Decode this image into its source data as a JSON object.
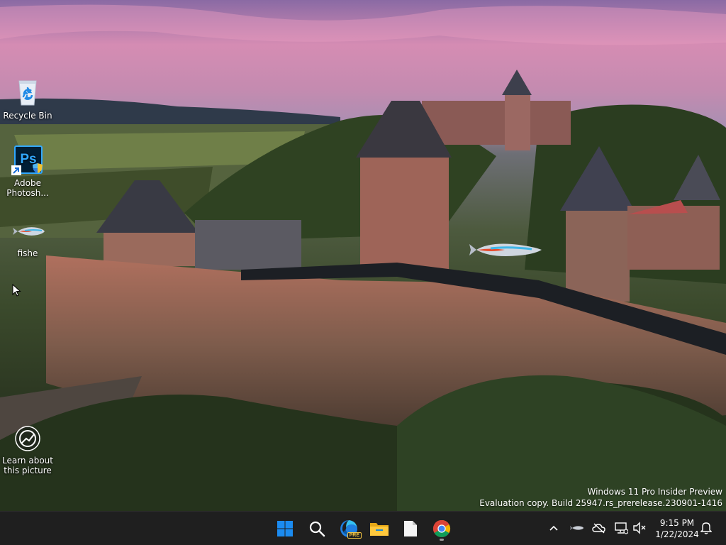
{
  "desktop": {
    "icons": [
      {
        "label": "Recycle Bin",
        "icon": "recycle-bin-icon"
      },
      {
        "label": "Adobe Photosh...",
        "icon": "photoshop-icon",
        "glyph": "Ps"
      },
      {
        "label": "fishe",
        "icon": "fish-icon"
      },
      {
        "label": "Learn about this picture",
        "icon": "learn-about-picture-icon"
      }
    ],
    "watermark": {
      "line1": "Windows 11 Pro Insider Preview",
      "line2": "Evaluation copy. Build 25947.rs_prerelease.230901-1416"
    }
  },
  "taskbar": {
    "apps": [
      {
        "name": "Start",
        "icon": "windows-start-icon"
      },
      {
        "name": "Search",
        "icon": "search-icon"
      },
      {
        "name": "Microsoft Edge Preview",
        "icon": "edge-icon",
        "badge": "PRE"
      },
      {
        "name": "File Explorer",
        "icon": "folder-icon"
      },
      {
        "name": "Notepad",
        "icon": "notepad-icon"
      },
      {
        "name": "Google Chrome",
        "icon": "chrome-icon",
        "running": true
      }
    ],
    "tray": {
      "icons": [
        "chevron-up-icon",
        "fish-tray-icon",
        "cloud-offline-icon",
        "network-icon",
        "volume-muted-icon",
        "notification-bell-icon"
      ],
      "time": "9:15 PM",
      "date": "1/22/2024"
    }
  },
  "colors": {
    "taskbar_bg": "#1f1f1f",
    "start_blue": "#1b8bf0",
    "photoshop_bg": "#001e36",
    "photoshop_text": "#31a8ff"
  }
}
